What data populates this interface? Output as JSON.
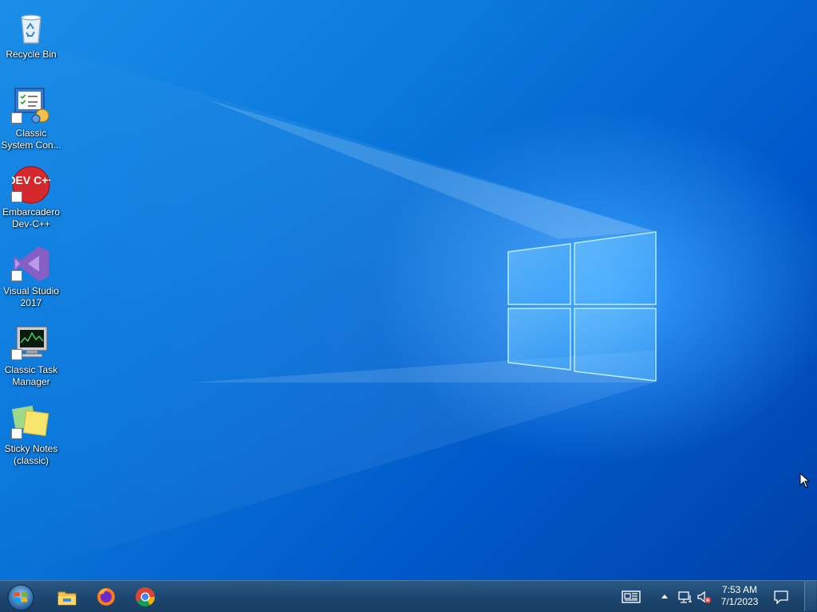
{
  "colors": {
    "wallpaper_top": "#1a8ee8",
    "wallpaper_bottom": "#0040a8",
    "taskbar": "#1d4770",
    "label_text": "#ffffff"
  },
  "desktop": {
    "icons": [
      {
        "label": "Recycle Bin",
        "icon": "recycle-bin-icon"
      },
      {
        "label": "Classic System Con...",
        "icon": "system-control-icon"
      },
      {
        "label": "Embarcadero Dev-C++",
        "icon": "dev-cpp-icon"
      },
      {
        "label": "Visual Studio 2017",
        "icon": "visual-studio-icon"
      },
      {
        "label": "Classic Task Manager",
        "icon": "task-manager-icon"
      },
      {
        "label": "Sticky Notes (classic)",
        "icon": "sticky-notes-icon"
      }
    ],
    "devcpp_logo_text": "DEV C++"
  },
  "taskbar": {
    "start": "start-orb-icon",
    "pinned": [
      {
        "name": "File Explorer",
        "icon": "file-explorer-icon"
      },
      {
        "name": "Firefox",
        "icon": "firefox-icon"
      },
      {
        "name": "Chrome",
        "icon": "chrome-icon"
      }
    ],
    "tray": {
      "time": "7:53 AM",
      "date": "7/1/2023"
    }
  }
}
